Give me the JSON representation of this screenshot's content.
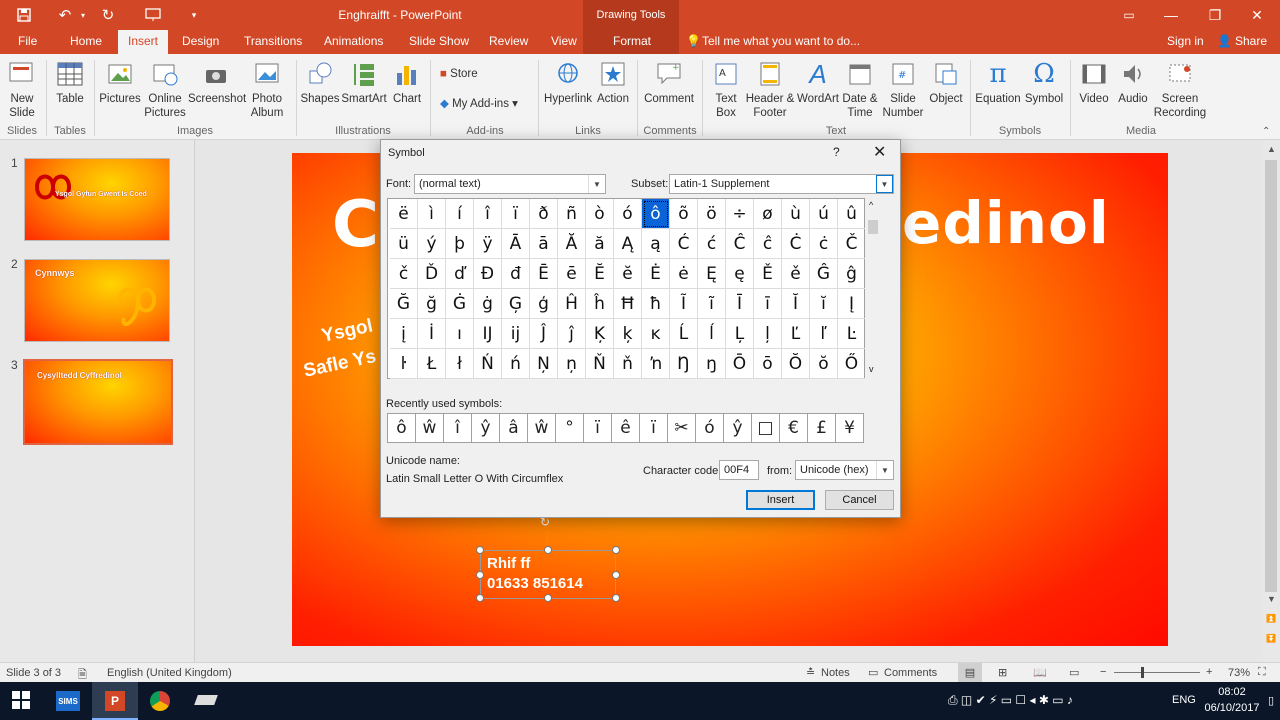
{
  "titlebar": {
    "doc_title": "Enghraifft - PowerPoint",
    "context_group": "Drawing Tools",
    "save_icon": "save-icon",
    "undo_icon": "undo-icon",
    "redo_icon": "redo-icon"
  },
  "tabs": {
    "file": "File",
    "home": "Home",
    "insert": "Insert",
    "design": "Design",
    "transitions": "Transitions",
    "animations": "Animations",
    "slideshow": "Slide Show",
    "review": "Review",
    "view": "View",
    "format": "Format",
    "tellme": "Tell me what you want to do...",
    "signin": "Sign in",
    "share": "Share"
  },
  "ribbon": {
    "new_slide": "New Slide",
    "table": "Table",
    "pictures": "Pictures",
    "online_pictures": "Online Pictures",
    "screenshot": "Screenshot",
    "photo_album": "Photo Album",
    "shapes": "Shapes",
    "smartart": "SmartArt",
    "chart": "Chart",
    "store": "Store",
    "my_addins": "My Add-ins",
    "hyperlink": "Hyperlink",
    "action": "Action",
    "comment": "Comment",
    "text_box": "Text Box",
    "header_footer": "Header & Footer",
    "wordart": "WordArt",
    "date_time": "Date & Time",
    "slide_number": "Slide Number",
    "object": "Object",
    "equation": "Equation",
    "symbol": "Symbol",
    "video": "Video",
    "audio": "Audio",
    "screen_recording": "Screen Recording",
    "groups": {
      "slides": "Slides",
      "tables": "Tables",
      "images": "Images",
      "illustrations": "Illustrations",
      "addins": "Add-ins",
      "links": "Links",
      "comments": "Comments",
      "text": "Text",
      "symbols": "Symbols",
      "media": "Media"
    }
  },
  "thumbnails": [
    {
      "num": "1",
      "title": "Ysgol Gyfun Gwent Is Coed"
    },
    {
      "num": "2",
      "title": "Cynnwys"
    },
    {
      "num": "3",
      "title": "Cysylltedd Cyffredinol"
    }
  ],
  "slide": {
    "title_partial": "edinol",
    "title_left": "C",
    "rotated_line1": "Ysgol",
    "rotated_line2": "Safle Ys",
    "textbox_line1": "Rhif ff",
    "textbox_line2": "01633 851614"
  },
  "dialog": {
    "title": "Symbol",
    "help": "?",
    "font_label": "Font:",
    "font_value": "(normal text)",
    "subset_label": "Subset:",
    "subset_value": "Latin-1 Supplement",
    "grid": [
      [
        "ë",
        "ì",
        "í",
        "î",
        "ï",
        "ð",
        "ñ",
        "ò",
        "ó",
        "ô",
        "õ",
        "ö",
        "÷",
        "ø",
        "ù",
        "ú",
        "û"
      ],
      [
        "ü",
        "ý",
        "þ",
        "ÿ",
        "Ā",
        "ā",
        "Ă",
        "ă",
        "Ą",
        "ą",
        "Ć",
        "ć",
        "Ĉ",
        "ĉ",
        "Ċ",
        "ċ",
        "Č"
      ],
      [
        "č",
        "Ď",
        "ď",
        "Đ",
        "đ",
        "Ē",
        "ē",
        "Ĕ",
        "ĕ",
        "Ė",
        "ė",
        "Ę",
        "ę",
        "Ě",
        "ě",
        "Ĝ",
        "ĝ"
      ],
      [
        "Ğ",
        "ğ",
        "Ġ",
        "ġ",
        "Ģ",
        "ģ",
        "Ĥ",
        "ĥ",
        "Ħ",
        "ħ",
        "Ĩ",
        "ĩ",
        "Ī",
        "ī",
        "Ĭ",
        "ĭ",
        "Į"
      ],
      [
        "į",
        "İ",
        "ı",
        "Ĳ",
        "ĳ",
        "Ĵ",
        "ĵ",
        "Ķ",
        "ķ",
        "ĸ",
        "Ĺ",
        "ĺ",
        "Ļ",
        "ļ",
        "Ľ",
        "ľ",
        "Ŀ"
      ],
      [
        "ŀ",
        "Ł",
        "ł",
        "Ń",
        "ń",
        "Ņ",
        "ņ",
        "Ň",
        "ň",
        "ŉ",
        "Ŋ",
        "ŋ",
        "Ō",
        "ō",
        "Ŏ",
        "ŏ",
        "Ő"
      ]
    ],
    "selected_symbol": "ô",
    "recent_label": "Recently used symbols:",
    "recent": [
      "ô",
      "ŵ",
      "î",
      "ŷ",
      "â",
      "ŵ",
      "°",
      "ï",
      "ê",
      "ï",
      "✂",
      "ó",
      "ŷ",
      "□",
      "€",
      "£",
      "¥"
    ],
    "unicode_name_label": "Unicode name:",
    "unicode_name": "Latin Small Letter O With Circumflex",
    "char_code_label": "Character code:",
    "char_code": "00F4",
    "from_label": "from:",
    "from_value": "Unicode (hex)",
    "insert": "Insert",
    "cancel": "Cancel"
  },
  "status": {
    "slide_of": "Slide 3 of 3",
    "language": "English (United Kingdom)",
    "notes": "Notes",
    "comments": "Comments",
    "zoom": "73%"
  },
  "taskbar": {
    "sims": "SIMS",
    "language": "ENG",
    "time": "08:02",
    "date": "06/10/2017"
  },
  "colors": {
    "accent": "#d24726",
    "selection": "#0a64d8"
  }
}
